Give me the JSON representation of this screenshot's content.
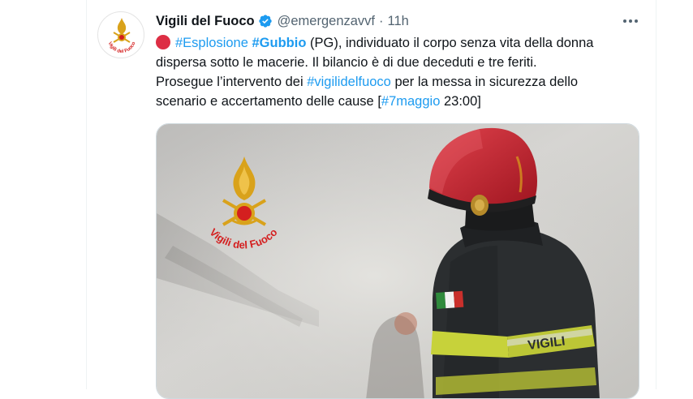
{
  "tweet": {
    "display_name": "Vigili del Fuoco",
    "handle": "@emergenzavvf",
    "separator": "·",
    "time": "11h",
    "more_icon": "more-horizontal-icon",
    "verified_icon": "verified-badge-icon",
    "status_emoji": "red-circle-icon",
    "lines": [
      [
        {
          "text": "#Esplosione",
          "type": "link"
        },
        {
          "text": " ",
          "type": "text"
        },
        {
          "text": "#Gubbio",
          "type": "link-bold"
        },
        {
          "text": " (PG), individuato il corpo senza vita della donna",
          "type": "text"
        }
      ],
      [
        {
          "text": "dispersa sotto le macerie. Il bilancio è di due deceduti e tre feriti.",
          "type": "text"
        }
      ],
      [
        {
          "text": "Prosegue l’intervento dei ",
          "type": "text"
        },
        {
          "text": "#vigilidelfuoco",
          "type": "link"
        },
        {
          "text": " per la messa in sicurezza dello",
          "type": "text"
        }
      ],
      [
        {
          "text": "scenario e accertamento delle cause [",
          "type": "text"
        },
        {
          "text": "#7maggio",
          "type": "link"
        },
        {
          "text": " 23:00]",
          "type": "text"
        }
      ]
    ],
    "avatar_text": "Vigili del Fuoco",
    "media": {
      "logo_text": "Vigili del Fuoco",
      "patch_text": "VIGILI",
      "colors": {
        "brand_red": "#d41f1f",
        "gold": "#d9a21b",
        "smoke": "#c9c9c7",
        "helmet": "#c51f2a",
        "jacket": "#2b2e30",
        "reflective": "#c7d23a"
      }
    },
    "colors": {
      "link": "#1d9bf0",
      "text": "#0f1419",
      "muted": "#536471"
    }
  }
}
